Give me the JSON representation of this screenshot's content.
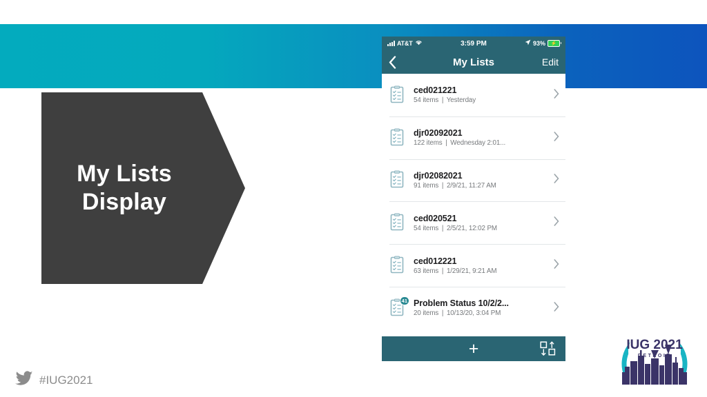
{
  "slide": {
    "callout": {
      "line1": "My Lists",
      "line2": "Display"
    },
    "banner_color_left": "#03abbe",
    "banner_color_right": "#0d54bd",
    "hashtag": "#IUG2021",
    "twitter_icon": "twitter-bird-icon"
  },
  "phone": {
    "status_bar": {
      "carrier": "AT&T",
      "signal_icon": "signal-bars-icon",
      "wifi_icon": "wifi-icon",
      "time": "3:59 PM",
      "location_icon": "location-arrow-icon",
      "battery_percent": "93%",
      "battery_icon": "battery-charging-icon"
    },
    "nav": {
      "back_icon": "chevron-left-icon",
      "title": "My Lists",
      "edit_label": "Edit",
      "bar_color": "#2a6573"
    },
    "lists": [
      {
        "icon": "checklist-document-icon",
        "title": "ced021221",
        "count": "54 items",
        "separator": "|",
        "timestamp": "Yesterday",
        "chevron": "chevron-right-icon",
        "badge": null
      },
      {
        "icon": "checklist-document-icon",
        "title": "djr02092021",
        "count": "122 items",
        "separator": "|",
        "timestamp": "Wednesday 2:01...",
        "chevron": "chevron-right-icon",
        "badge": null
      },
      {
        "icon": "checklist-document-icon",
        "title": "djr02082021",
        "count": "91 items",
        "separator": "|",
        "timestamp": "2/9/21, 11:27 AM",
        "chevron": "chevron-right-icon",
        "badge": null
      },
      {
        "icon": "checklist-document-icon",
        "title": "ced020521",
        "count": "54 items",
        "separator": "|",
        "timestamp": "2/5/21, 12:02 PM",
        "chevron": "chevron-right-icon",
        "badge": null
      },
      {
        "icon": "checklist-document-icon",
        "title": "ced012221",
        "count": "63 items",
        "separator": "|",
        "timestamp": "1/29/21, 9:21 AM",
        "chevron": "chevron-right-icon",
        "badge": null
      },
      {
        "icon": "checklist-document-icon",
        "title": "Problem Status 10/2/2...",
        "count": "20 items",
        "separator": "|",
        "timestamp": "10/13/20, 3:04 PM",
        "chevron": "chevron-right-icon",
        "badge": "41"
      }
    ],
    "toolbar": {
      "add_label": "+",
      "add_icon": "plus-icon",
      "sort_icon": "sort-reorder-icon",
      "bar_color": "#2a6573"
    }
  },
  "logo": {
    "title": "IUG 2021",
    "subtitle": "DETROIT",
    "arc_color": "#19b5c4",
    "text_color": "#3b3468"
  }
}
